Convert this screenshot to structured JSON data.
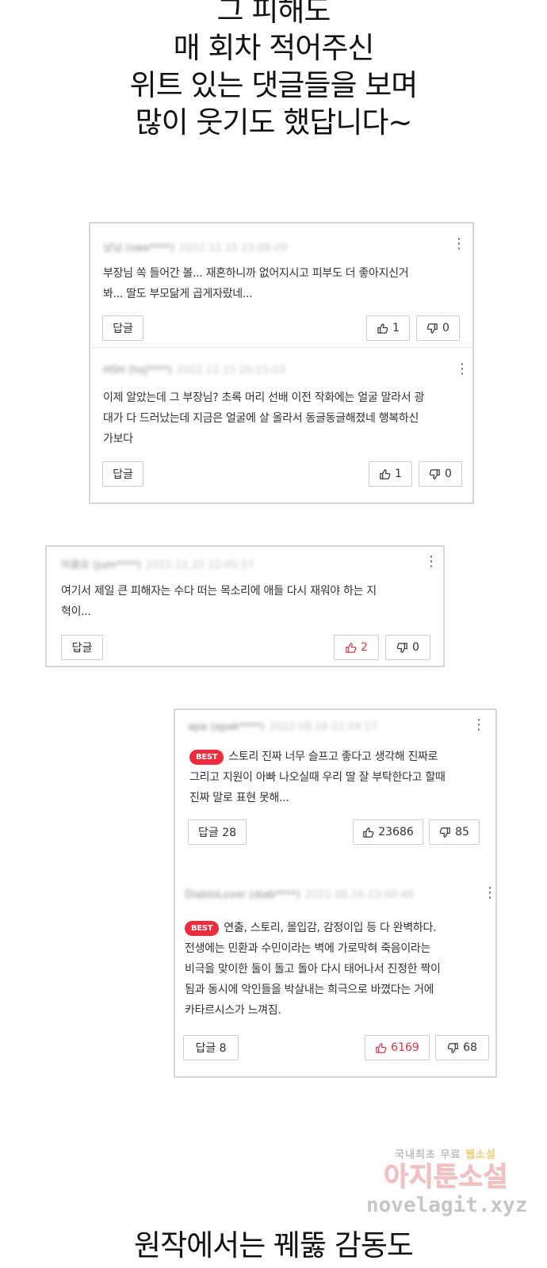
{
  "narration_top": {
    "lines": [
      "그 피해도",
      "매 회차 적어주신",
      "위트 있는 댓글들을 보며",
      "많이 웃기도 했답니다~"
    ]
  },
  "cards": [
    {
      "comments": [
        {
          "author": "낭닝 (swe****)",
          "date": "2022.12.15 23:08:09",
          "text_lines": [
            "부장님 쏙 들어간 볼... 재혼하니까 없어지시고 피부도 더 좋아지신거",
            "봐... 딸도 부모닮게 곱게자랐네..."
          ],
          "reply_label": "답글",
          "likes": "1",
          "dislikes": "0"
        },
        {
          "author": "HSH (hsj****)",
          "date": "2022.12.15 20:15:03",
          "text_lines": [
            "이제 알았는데 그 부장님? 초록 머리 선배 이전 작화에는 얼굴 말라서 광",
            "대가 다 드러났는데 지금은 얼굴에 살 올라서 동글동글해졌네 행복하신",
            "가보다"
          ],
          "reply_label": "답글",
          "likes": "1",
          "dislikes": "0"
        }
      ]
    },
    {
      "comments": [
        {
          "author": "미움요 (jum****)",
          "date": "2022.12.20 22:05:57",
          "text_lines": [
            "여기서 제일 큰 피해자는 수다 떠는 목소리에 애들 다시 재워야 하는 지",
            "혁이..."
          ],
          "reply_label": "답글",
          "likes": "2",
          "dislikes": "0"
        }
      ]
    },
    {
      "comments": [
        {
          "author": "apa (apak****)",
          "date": "2022.08.16 22:59:17",
          "best_label": "BEST",
          "text_lines": [
            "스토리 진짜 너무 슬프고 좋다고 생각해 진짜로",
            "그리고 지원이 아빠 나오실때 우리 딸 잘 부탁한다고 할때",
            "진짜 말로 표현 못해..."
          ],
          "reply_label": "답글 28",
          "likes": "23686",
          "dislikes": "85"
        },
        {
          "author": "DiabloLover (diab****)",
          "date": "2022.08.16 23:00:48",
          "best_label": "BEST",
          "text_lines": [
            "연출, 스토리, 몰입감, 감정이입 등 다 완벽하다.",
            "전생에는 민환과 수민이라는 벽에 가로막혀 죽음이라는",
            "비극을 맞이한 둘이 돌고 돌아 다시 태어나서 진정한 짝이",
            "됨과 동시에 악인들을 박살내는 희극으로 바꼈다는 거에",
            "카타르시스가 느껴짐."
          ],
          "reply_label": "답글 8",
          "likes": "6169",
          "dislikes": "68"
        }
      ]
    }
  ],
  "watermark": {
    "line1_prefix": "국내최초 무료",
    "line1_highlight": "웹소설",
    "line2": "아지툰소설",
    "line3": "novelagit.xyz"
  },
  "narration_bottom": {
    "text": "원작에서는 꿰뚫 감동도"
  },
  "icons": {
    "like": "thumbs-up-icon",
    "dislike": "thumbs-down-icon",
    "more": "more-vertical-icon"
  },
  "colors": {
    "best_badge": "#ee2a3c",
    "liked_red": "#e0303f",
    "card_border": "#d6d6d6"
  }
}
